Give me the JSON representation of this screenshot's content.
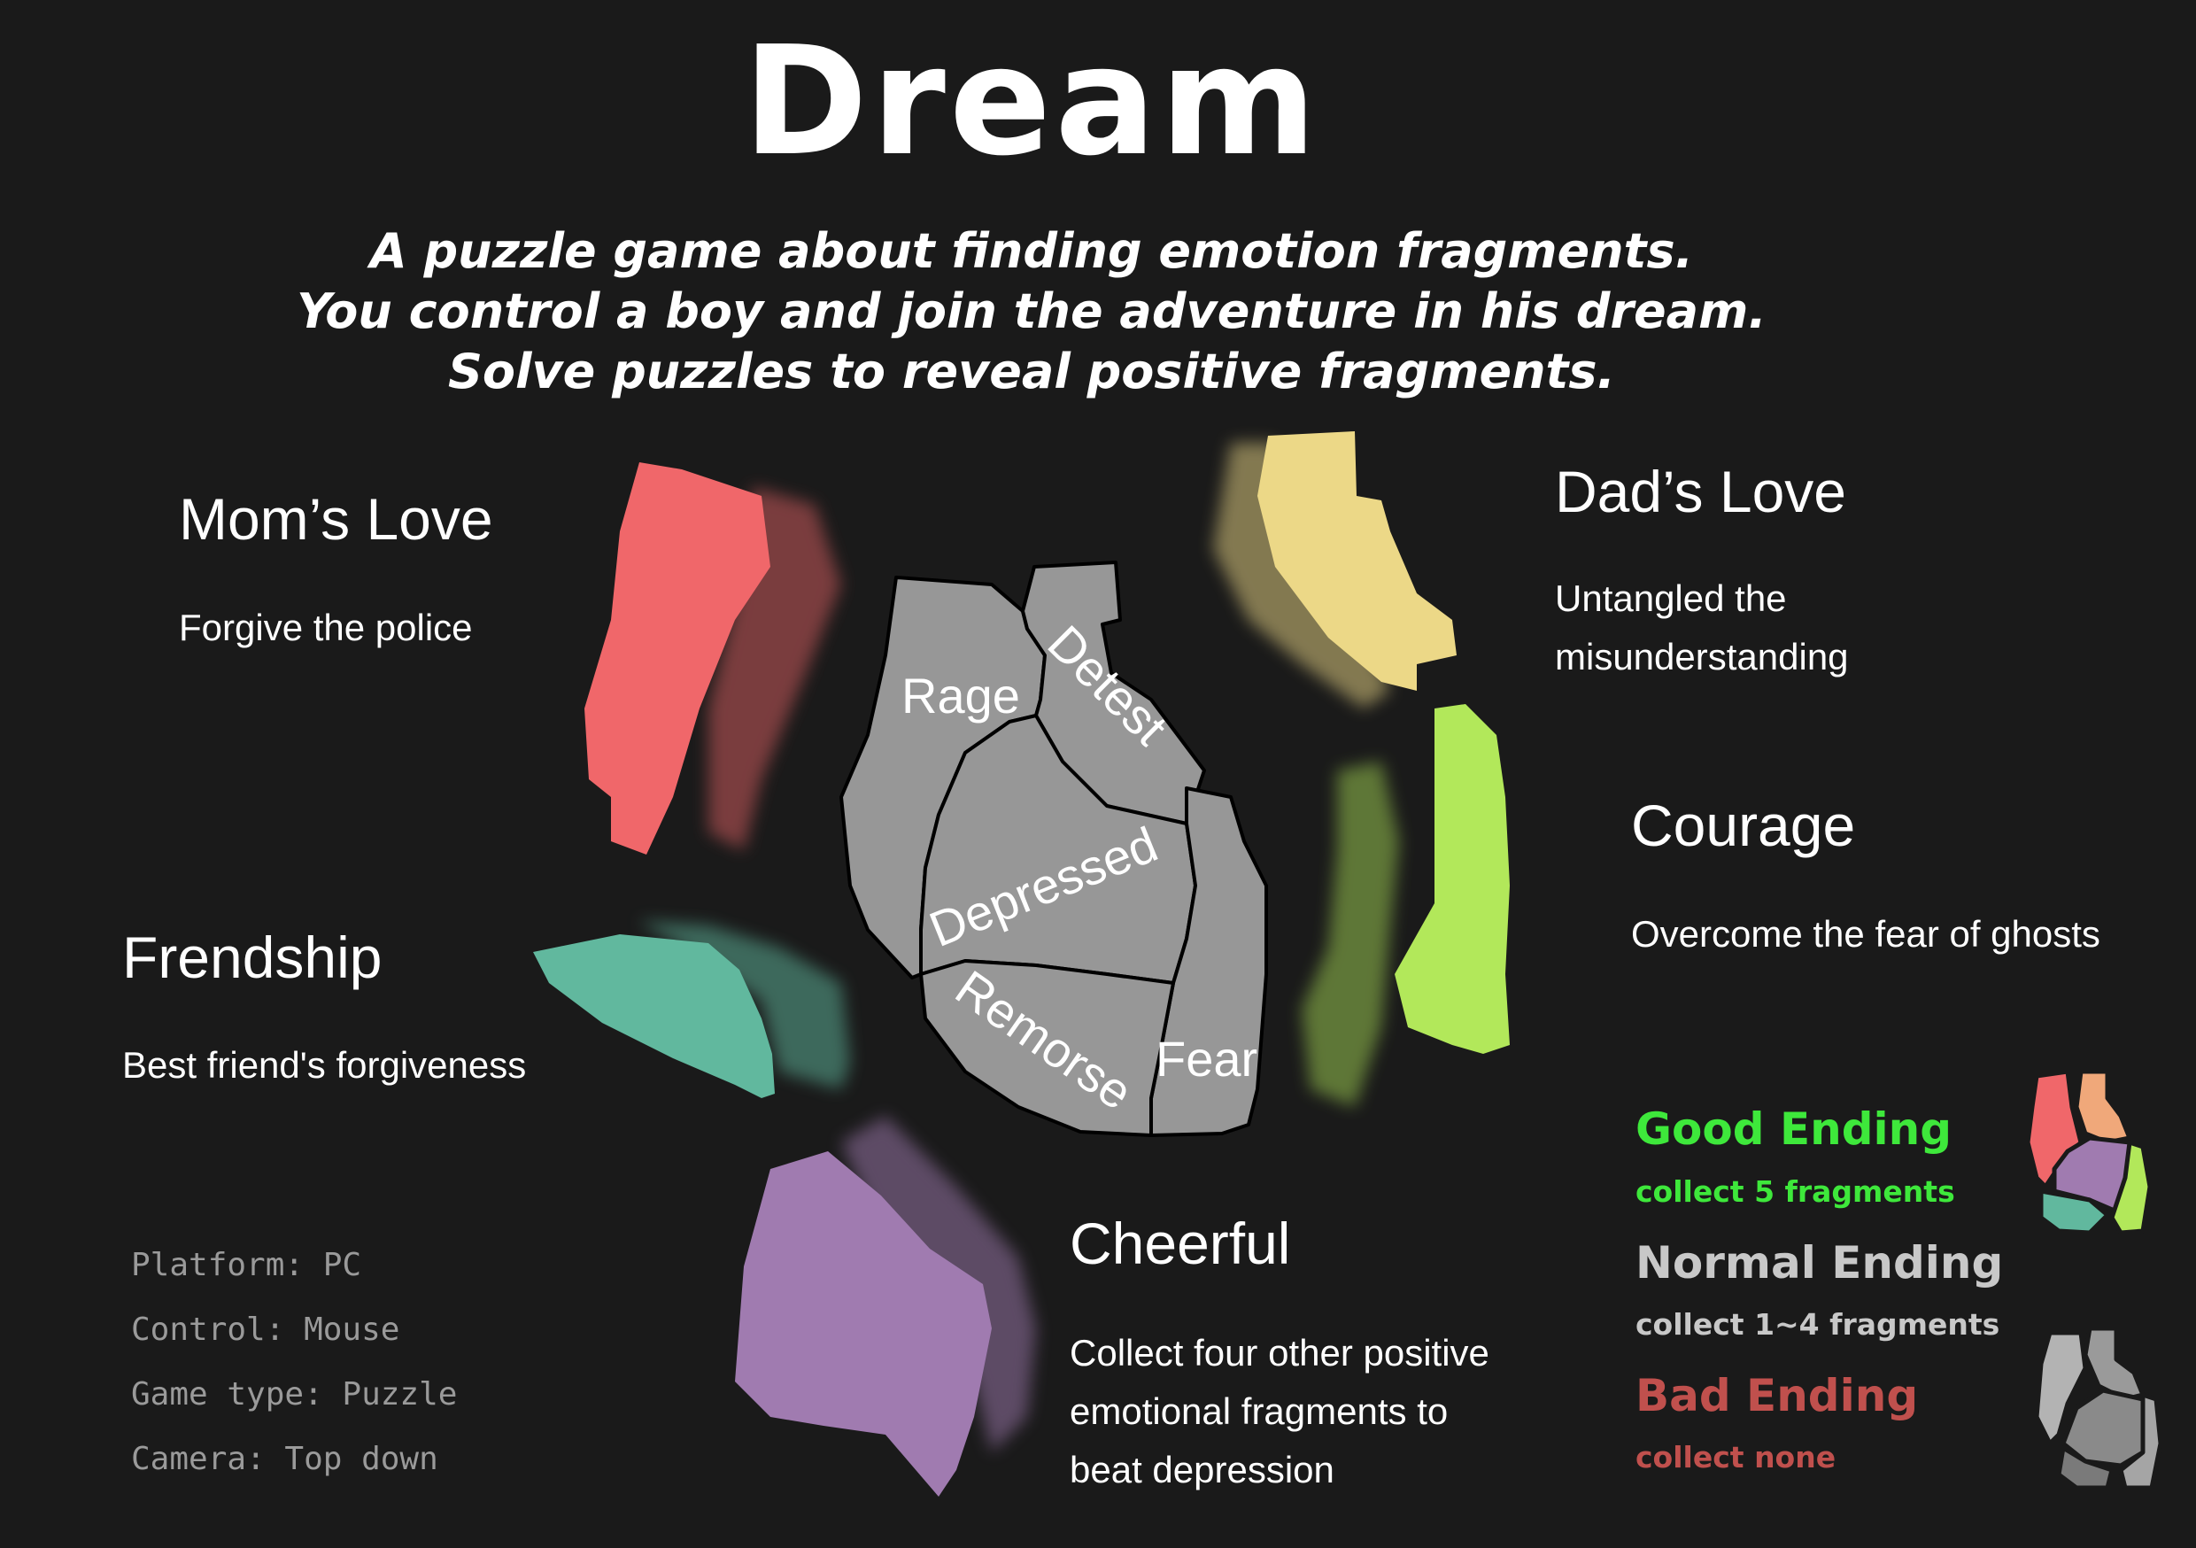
{
  "title": "Dream",
  "tagline": [
    "A puzzle game about finding emotion fragments.",
    "You control a boy and join the adventure in his dream.",
    "Solve puzzles to reveal positive fragments."
  ],
  "fragments": {
    "moms_love": {
      "title": "Mom’s Love",
      "desc": "Forgive the police",
      "color": "#f0676a"
    },
    "dads_love": {
      "title": "Dad’s Love",
      "desc": "Untangled the misunderstanding",
      "color": "#ecd887"
    },
    "courage": {
      "title": "Courage",
      "desc": "Overcome the fear of ghosts",
      "color": "#b2e85a"
    },
    "friendship": {
      "title": "Frendship",
      "desc": "Best friend's forgiveness",
      "color": "#61b89e"
    },
    "cheerful": {
      "title": "Cheerful",
      "desc_lines": [
        "Collect four other positive",
        "emotional fragments to",
        "beat depression"
      ],
      "color": "#a07bb0"
    }
  },
  "heart": {
    "color": "#979797",
    "labels": {
      "rage": "Rage",
      "detest": "Detest",
      "depressed": "Depressed",
      "remorse": "Remorse",
      "fear": "Fear"
    }
  },
  "info": [
    "Platform: PC",
    "Control: Mouse",
    "Game type: Puzzle",
    "Camera: Top down"
  ],
  "endings": {
    "good": {
      "title": "Good Ending",
      "sub": "collect 5 fragments",
      "color": "#3ee83b"
    },
    "normal": {
      "title": "Normal Ending",
      "sub": "collect 1~4 fragments",
      "color": "#c8c8c8"
    },
    "bad": {
      "title": "Bad Ending",
      "sub": "collect none",
      "color": "#c0504d"
    }
  }
}
